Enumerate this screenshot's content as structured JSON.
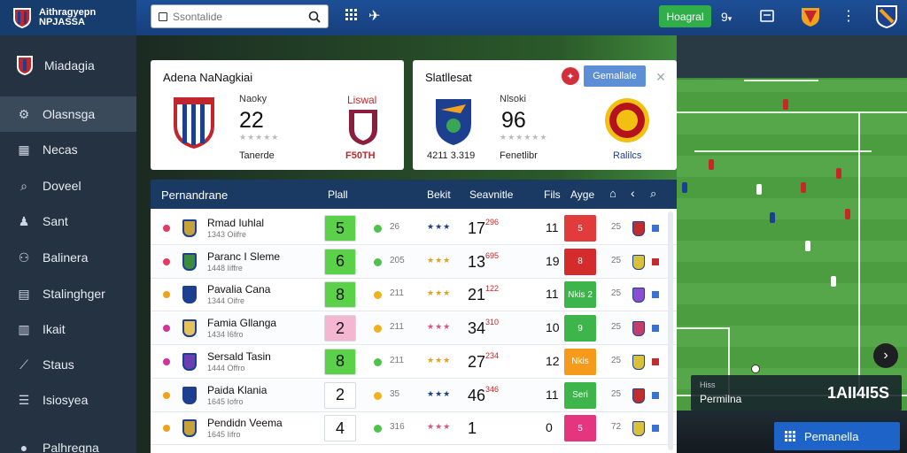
{
  "header": {
    "brand_line1": "Aithragyepn",
    "brand_line2": "NPJASSA",
    "search_placeholder": "Ssontalide",
    "register_label": "Hoagral",
    "lang_label": "9"
  },
  "sidebar": {
    "title": "Miadagia",
    "items": [
      {
        "label": "Olasnsga",
        "icon": "settings-icon"
      },
      {
        "label": "Necas",
        "icon": "news-icon"
      },
      {
        "label": "Doveel",
        "icon": "search-icon"
      },
      {
        "label": "Sant",
        "icon": "users-icon"
      },
      {
        "label": "Balinera",
        "icon": "team-icon"
      },
      {
        "label": "Stalinghger",
        "icon": "grid-icon"
      },
      {
        "label": "Ikait",
        "icon": "chart-icon"
      },
      {
        "label": "Staus",
        "icon": "tag-icon"
      },
      {
        "label": "Isiosyea",
        "icon": "list-icon"
      },
      {
        "label": "Palhregna",
        "icon": "user-icon"
      }
    ]
  },
  "card1": {
    "title": "Adena NaNagkiai",
    "stat_label": "Naoky",
    "stat_value": "22",
    "footer_left": "Tanerde",
    "right_label": "Liswal",
    "footer_right": "F50TH",
    "colors": {
      "crest_left": "#1c3f8f",
      "crest_right": "#8b1e3f"
    }
  },
  "card2": {
    "title": "Slatllesat",
    "gen_button": "Gemallale",
    "stat_label": "Nlsoki",
    "stat_value": "96",
    "footer_left": "4211 3.319",
    "footer_mid": "Fenetlibr",
    "footer_right": "Ralilcs"
  },
  "table": {
    "headers": {
      "name": "Pernandrane",
      "p": "Plall",
      "bekt": "Bekit",
      "season": "Seavnitle",
      "fis": "Fils",
      "age": "Ayge"
    },
    "rows": [
      {
        "name": "Rmad Iuhlal",
        "sub": "1343 Oiifre",
        "p": "5",
        "p_color": "#5bd14a",
        "g": "26",
        "g_color": "#4ec24a",
        "stars": "★★★",
        "star_color": "#1b3f8f",
        "s": "17",
        "s_small": "296",
        "f": "11",
        "a": "5",
        "a_color": "#e23b3b",
        "n": "25",
        "dot": "#e23b66",
        "crest": "#c7a23b",
        "mini": "#c12d2d",
        "sq": "#3a72d4"
      },
      {
        "name": "Paranc I Sleme",
        "sub": "1448 Iiffre",
        "p": "6",
        "p_color": "#5bd14a",
        "g": "205",
        "g_color": "#4ec24a",
        "stars": "★★★",
        "star_color": "#e0a11f",
        "s": "13",
        "s_small": "695",
        "f": "19",
        "a": "8",
        "a_color": "#d42c2c",
        "n": "25",
        "dot": "#e23b66",
        "crest": "#3d8b3d",
        "mini": "#d9c23a",
        "sq": "#c12d2d"
      },
      {
        "name": "Pavalia Cana",
        "sub": "1344 Oifre",
        "p": "8",
        "p_color": "#5bd14a",
        "g": "211",
        "g_color": "#f0b21c",
        "stars": "★★★",
        "star_color": "#e0a11f",
        "s": "21",
        "s_small": "122",
        "f": "11",
        "a": "Nkis 2",
        "a_color": "#3db54a",
        "n": "25",
        "dot": "#f0a21c",
        "crest": "#1c3f8f",
        "mini": "#8a4fd0",
        "sq": "#3a72d4"
      },
      {
        "name": "Famia Gllanga",
        "sub": "1434 I6fro",
        "p": "2",
        "p_color": "#f4b6d0",
        "g": "211",
        "g_color": "#f0b21c",
        "stars": "★★★",
        "star_color": "#d9537a",
        "s": "34",
        "s_small": "310",
        "f": "10",
        "a": "9",
        "a_color": "#3db54a",
        "n": "25",
        "dot": "#d0339b",
        "crest": "#e7c25b",
        "mini": "#c23d6a",
        "sq": "#3a72d4"
      },
      {
        "name": "Sersald Tasin",
        "sub": "1444 Offro",
        "p": "8",
        "p_color": "#5bd14a",
        "g": "211",
        "g_color": "#4ec24a",
        "stars": "★★★",
        "star_color": "#e0a11f",
        "s": "27",
        "s_small": "234",
        "f": "12",
        "a": "Nkis",
        "a_color": "#f59a1b",
        "n": "25",
        "dot": "#d0339b",
        "crest": "#6a3fb0",
        "mini": "#d9c23a",
        "sq": "#c12d2d"
      },
      {
        "name": "Paida Klania",
        "sub": "1645 Iofro",
        "p": "2",
        "p_color": "#ffffff",
        "g": "35",
        "g_color": "#f0b21c",
        "stars": "★★★",
        "star_color": "#1b3f8f",
        "s": "46",
        "s_small": "346",
        "f": "11",
        "a": "Seri",
        "a_color": "#3db54a",
        "n": "25",
        "dot": "#f0a21c",
        "crest": "#1c3f8f",
        "mini": "#c12d2d",
        "sq": "#3a72d4"
      },
      {
        "name": "Pendidn Veema",
        "sub": "1645 Iifro",
        "p": "4",
        "p_color": "#ffffff",
        "g": "316",
        "g_color": "#4ec24a",
        "stars": "★★★",
        "star_color": "#d9537a",
        "s": "1",
        "s_small": "",
        "f": "0",
        "a": "5",
        "a_color": "#e6357f",
        "n": "72",
        "dot": "#f0a21c",
        "crest": "#c7a23b",
        "mini": "#d9c23a",
        "sq": "#3a72d4"
      }
    ]
  },
  "promo": {
    "kicker": "Hiss",
    "title": "Permilna",
    "value": "1AII4I5S"
  },
  "bottom_button": "Pemanella"
}
